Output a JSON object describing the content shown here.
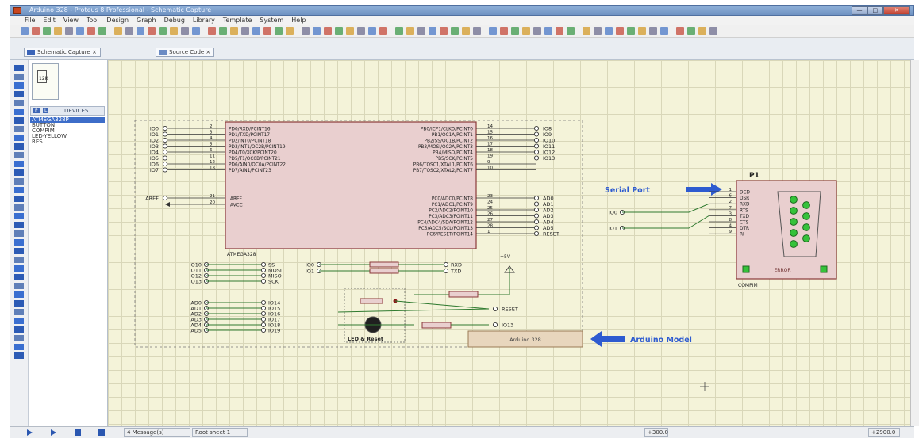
{
  "window": {
    "title": "Arduino 328 - Proteus 8 Professional - Schematic Capture",
    "controls": [
      "—",
      "□",
      "✕"
    ]
  },
  "menu": [
    "File",
    "Edit",
    "View",
    "Tool",
    "Design",
    "Graph",
    "Debug",
    "Library",
    "Template",
    "System",
    "Help"
  ],
  "tabs": [
    "Schematic Capture",
    "Source Code"
  ],
  "devices_panel": {
    "header_p": "P",
    "header_l": "L",
    "header": "DEVICES",
    "preview_label": "12K",
    "items": [
      "ATMEGA328P",
      "BUTTON",
      "COMPIM",
      "LED-YELLOW",
      "RES"
    ],
    "selected_index": 0
  },
  "mcu": {
    "part": "ATMEGA328",
    "left_pins": [
      {
        "label": "IO0",
        "num": "2",
        "name": "PD0/RXD/PCINT16"
      },
      {
        "label": "IO1",
        "num": "3",
        "name": "PD1/TXD/PCINT17"
      },
      {
        "label": "IO2",
        "num": "4",
        "name": "PD2/INT0/PCINT18"
      },
      {
        "label": "IO3",
        "num": "5",
        "name": "PD3/INT1/OC2B/PCINT19"
      },
      {
        "label": "IO4",
        "num": "6",
        "name": "PD4/T0/XCK/PCINT20"
      },
      {
        "label": "IO5",
        "num": "11",
        "name": "PD5/T1/OC0B/PCINT21"
      },
      {
        "label": "IO6",
        "num": "12",
        "name": "PD6/AIN0/OC0A/PCINT22"
      },
      {
        "label": "IO7",
        "num": "13",
        "name": "PD7/AIN1/PCINT23"
      }
    ],
    "right_pins": [
      {
        "label": "IO8",
        "num": "14",
        "name": "PB0/ICP1/CLKO/PCINT0"
      },
      {
        "label": "IO9",
        "num": "15",
        "name": "PB1/OC1A/PCINT1"
      },
      {
        "label": "IO10",
        "num": "16",
        "name": "PB2/SS/OC1B/PCINT2"
      },
      {
        "label": "IO11",
        "num": "17",
        "name": "PB3/MOSI/OC2A/PCINT3"
      },
      {
        "label": "IO12",
        "num": "18",
        "name": "PB4/MISO/PCINT4"
      },
      {
        "label": "IO13",
        "num": "19",
        "name": "PB5/SCK/PCINT5"
      },
      {
        "label": "",
        "num": "9",
        "name": "PB6/TOSC1/XTAL1/PCINT6"
      },
      {
        "label": "",
        "num": "10",
        "name": "PB7/TOSC2/XTAL2/PCINT7"
      }
    ],
    "aref": {
      "label": "AREF",
      "num": "21",
      "name": "AREF"
    },
    "avcc": {
      "num": "20",
      "name": "AVCC"
    },
    "analog_pins": [
      {
        "label": "AD0",
        "num": "23",
        "name": "PC0/ADC0/PCINT8"
      },
      {
        "label": "AD1",
        "num": "24",
        "name": "PC1/ADC1/PCINT9"
      },
      {
        "label": "AD2",
        "num": "25",
        "name": "PC2/ADC2/PCINT10"
      },
      {
        "label": "AD3",
        "num": "26",
        "name": "PC3/ADC3/PCINT11"
      },
      {
        "label": "AD4",
        "num": "27",
        "name": "PC4/ADC4/SDA/PCINT12"
      },
      {
        "label": "AD5",
        "num": "28",
        "name": "PC5/ADC5/SCL/PCINT13"
      },
      {
        "label": "RESET",
        "num": "1",
        "name": "PC6/RESET/PCINT14"
      }
    ]
  },
  "spi_map": [
    {
      "from": "IO10",
      "to": "SS"
    },
    {
      "from": "IO11",
      "to": "MOSI"
    },
    {
      "from": "IO12",
      "to": "MISO"
    },
    {
      "from": "IO13",
      "to": "SCK"
    }
  ],
  "uart_map": [
    {
      "from": "IO0",
      "to": "RXD"
    },
    {
      "from": "IO1",
      "to": "TXD"
    }
  ],
  "analog_map": [
    {
      "from": "AD0",
      "to": "IO14"
    },
    {
      "from": "AD1",
      "to": "IO15"
    },
    {
      "from": "AD2",
      "to": "IO16"
    },
    {
      "from": "AD3",
      "to": "IO17"
    },
    {
      "from": "AD4",
      "to": "IO18"
    },
    {
      "from": "AD5",
      "to": "IO19"
    }
  ],
  "power_label": "+5V",
  "reset_label": "RESET",
  "led_out_label": "IO13",
  "led_block_label": "LED & Reset",
  "arduino_box_label": "Arduino 328",
  "annotations": {
    "serial": "Serial Port",
    "arduino": "Arduino Model"
  },
  "port": {
    "ref": "P1",
    "pins": [
      {
        "num": "1",
        "name": "DCD"
      },
      {
        "num": "6",
        "name": "DSR"
      },
      {
        "num": "2",
        "name": "RXD"
      },
      {
        "num": "7",
        "name": "RTS"
      },
      {
        "num": "3",
        "name": "TXD"
      },
      {
        "num": "8",
        "name": "CTS"
      },
      {
        "num": "4",
        "name": "DTR"
      },
      {
        "num": "9",
        "name": "RI"
      }
    ],
    "error_label": "ERROR",
    "part": "COMPIM",
    "inputs": [
      "IO0",
      "IO1"
    ]
  },
  "status": {
    "messages": "4 Message(s)",
    "sheet": "Root sheet 1",
    "coord1": "+300.0",
    "coord2": "+2900.0"
  },
  "colors": {
    "canvas": "#f4f3d9",
    "wire": "#2f7a2f",
    "component": "#8b3a3a",
    "chip_fill": "#e9cfcf",
    "annotation": "#2e5bd0"
  }
}
